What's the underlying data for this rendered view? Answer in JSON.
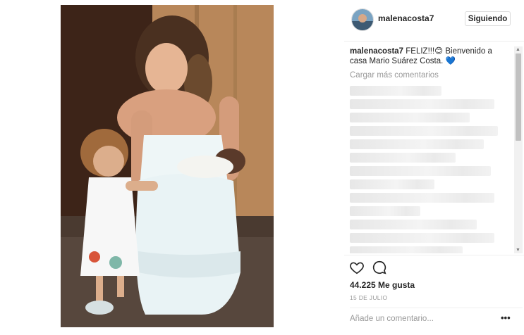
{
  "post": {
    "username": "malenacosta7",
    "follow_label": "Siguiendo"
  },
  "caption": {
    "author": "malenacosta7",
    "text": " FELIZ!!!😊 Bienvenido a casa Mario Suárez Costa. 💙"
  },
  "comments": {
    "load_more": "Cargar más comentarios",
    "blurred_rows": 13
  },
  "actions": {
    "likes": "44.225 Me gusta",
    "date": "15 DE JULIO",
    "add_comment_placeholder": "Añade un comentario...",
    "more_glyph": "•••"
  },
  "icons": {
    "like": "heart-icon",
    "comment": "comment-bubble-icon",
    "more": "more-options-icon"
  },
  "colors": {
    "text": "#262626",
    "muted": "#999999",
    "border": "#dbdbdb",
    "dress": "#e9f3f5",
    "wall_wood": "#b88a55"
  }
}
